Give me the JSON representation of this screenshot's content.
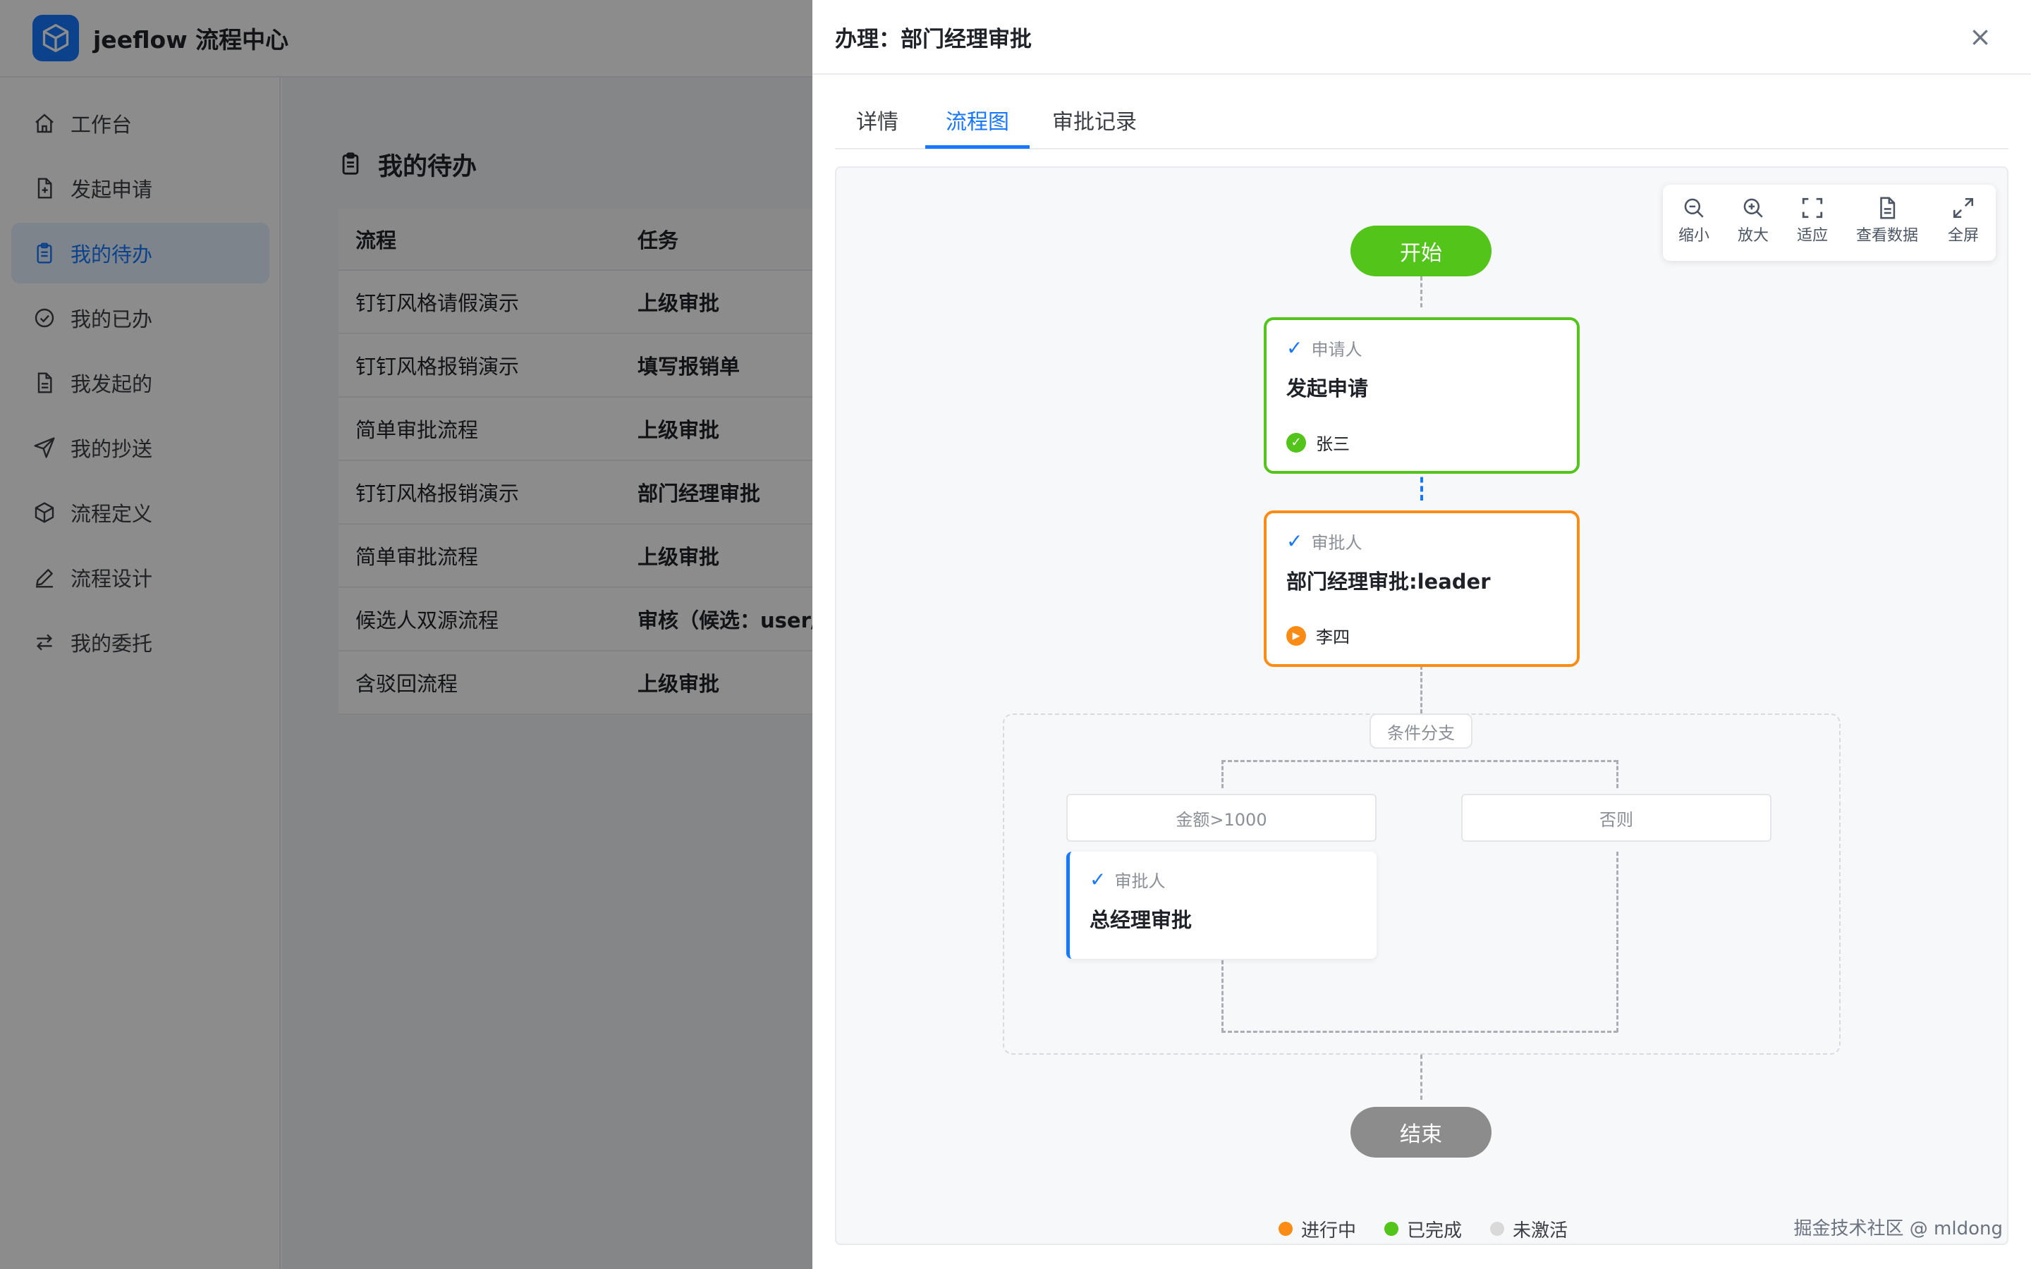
{
  "app": {
    "title": "jeeflow 流程中心"
  },
  "sidebar": {
    "items": [
      {
        "label": "工作台",
        "icon": "home-icon"
      },
      {
        "label": "发起申请",
        "icon": "file-plus-icon"
      },
      {
        "label": "我的待办",
        "icon": "clipboard-icon",
        "active": true
      },
      {
        "label": "我的已办",
        "icon": "check-circle-icon"
      },
      {
        "label": "我发起的",
        "icon": "document-icon"
      },
      {
        "label": "我的抄送",
        "icon": "send-icon"
      },
      {
        "label": "流程定义",
        "icon": "cube-icon"
      },
      {
        "label": "流程设计",
        "icon": "pen-icon"
      },
      {
        "label": "我的委托",
        "icon": "swap-icon"
      }
    ]
  },
  "page": {
    "title": "我的待办",
    "columns": [
      "流程",
      "任务"
    ],
    "rows": [
      {
        "process": "钉钉风格请假演示",
        "task": "上级审批"
      },
      {
        "process": "钉钉风格报销演示",
        "task": "填写报销单"
      },
      {
        "process": "简单审批流程",
        "task": "上级审批"
      },
      {
        "process": "钉钉风格报销演示",
        "task": "部门经理审批"
      },
      {
        "process": "简单审批流程",
        "task": "上级审批"
      },
      {
        "process": "候选人双源流程",
        "task": "审核（候选：user/"
      },
      {
        "process": "含驳回流程",
        "task": "上级审批"
      }
    ]
  },
  "drawer": {
    "title": "办理：部门经理审批",
    "close_label": "×",
    "tabs": [
      {
        "label": "详情"
      },
      {
        "label": "流程图",
        "active": true
      },
      {
        "label": "审批记录"
      }
    ]
  },
  "toolbox": {
    "zoom_out": "缩小",
    "zoom_in": "放大",
    "fit": "适应",
    "view_data": "查看数据",
    "fullscreen": "全屏"
  },
  "flow": {
    "start": "开始",
    "end": "结束",
    "nodes": [
      {
        "role": "申请人",
        "name": "发起申请",
        "assignee": "张三",
        "status": "completed"
      },
      {
        "role": "审批人",
        "name": "部门经理审批:leader",
        "assignee": "李四",
        "status": "active"
      },
      {
        "role": "审批人",
        "name": "总经理审批",
        "status": "inactive"
      }
    ],
    "branch_label": "条件分支",
    "conditions": [
      "金额>1000",
      "否则"
    ]
  },
  "legend": [
    {
      "label": "进行中",
      "color": "#fa8c16"
    },
    {
      "label": "已完成",
      "color": "#52c41a"
    },
    {
      "label": "未激活",
      "color": "#d9d9d9"
    }
  ],
  "colors": {
    "primary": "#1677ff",
    "completed": "#52c41a",
    "active": "#fa8c16",
    "end": "#8c8c8c"
  },
  "watermark": "掘金技术社区 @ mldong"
}
